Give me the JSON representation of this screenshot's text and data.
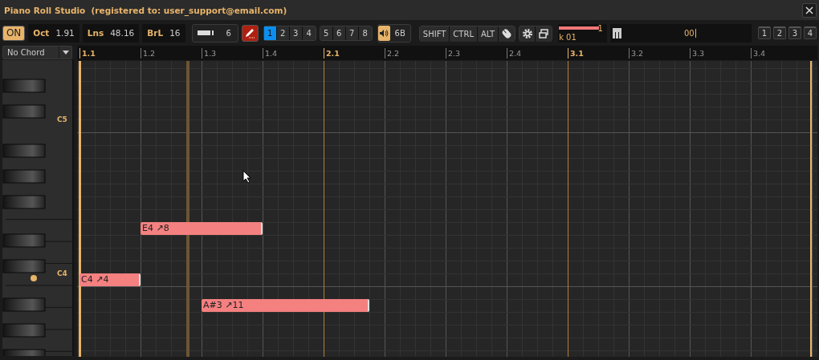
{
  "window": {
    "title": "Piano Roll Studio  (registered to: user_support@email.com)"
  },
  "toolbar": {
    "power": {
      "label": "ON",
      "on": true
    },
    "fields": [
      {
        "label": "Oct",
        "value": "1.91"
      },
      {
        "label": "Lns",
        "value": "48.16"
      },
      {
        "label": "BrL",
        "value": "16"
      }
    ],
    "zoom": {
      "value": "6"
    },
    "draw_tool": {
      "on": true
    },
    "channels": [
      {
        "label": "1",
        "selected": true
      },
      {
        "label": "2",
        "selected": false
      },
      {
        "label": "3",
        "selected": false
      },
      {
        "label": "4",
        "selected": false
      },
      {
        "label": "5",
        "selected": false
      },
      {
        "label": "6",
        "selected": false
      },
      {
        "label": "7",
        "selected": false
      },
      {
        "label": "8",
        "selected": false
      }
    ],
    "sound": {
      "on": true,
      "value": "6B"
    },
    "modifiers": [
      {
        "label": "SHIFT"
      },
      {
        "label": "CTRL"
      },
      {
        "label": "ALT"
      }
    ],
    "meter": {
      "level": 0.8,
      "value": "1",
      "label": "k 01"
    },
    "note_field": {
      "value": "00"
    },
    "presets": [
      {
        "label": "1"
      },
      {
        "label": "2"
      },
      {
        "label": "3"
      },
      {
        "label": "4"
      }
    ]
  },
  "chord": {
    "value": "No Chord"
  },
  "ruler": [
    {
      "label": "1.1",
      "bar": true
    },
    {
      "label": "1.2",
      "bar": false
    },
    {
      "label": "1.3",
      "bar": false
    },
    {
      "label": "1.4",
      "bar": false
    },
    {
      "label": "2.1",
      "bar": true
    },
    {
      "label": "2.2",
      "bar": false
    },
    {
      "label": "2.3",
      "bar": false
    },
    {
      "label": "2.4",
      "bar": false
    },
    {
      "label": "3.1",
      "bar": true
    },
    {
      "label": "3.2",
      "bar": false
    },
    {
      "label": "3.3",
      "bar": false
    },
    {
      "label": "3.4",
      "bar": false
    }
  ],
  "keyboard": {
    "labels": [
      "C5",
      "C4"
    ]
  },
  "notes": [
    {
      "label": "C4 ↗4"
    },
    {
      "label": "E4 ↗8"
    },
    {
      "label": "A#3 ↗11"
    }
  ]
}
